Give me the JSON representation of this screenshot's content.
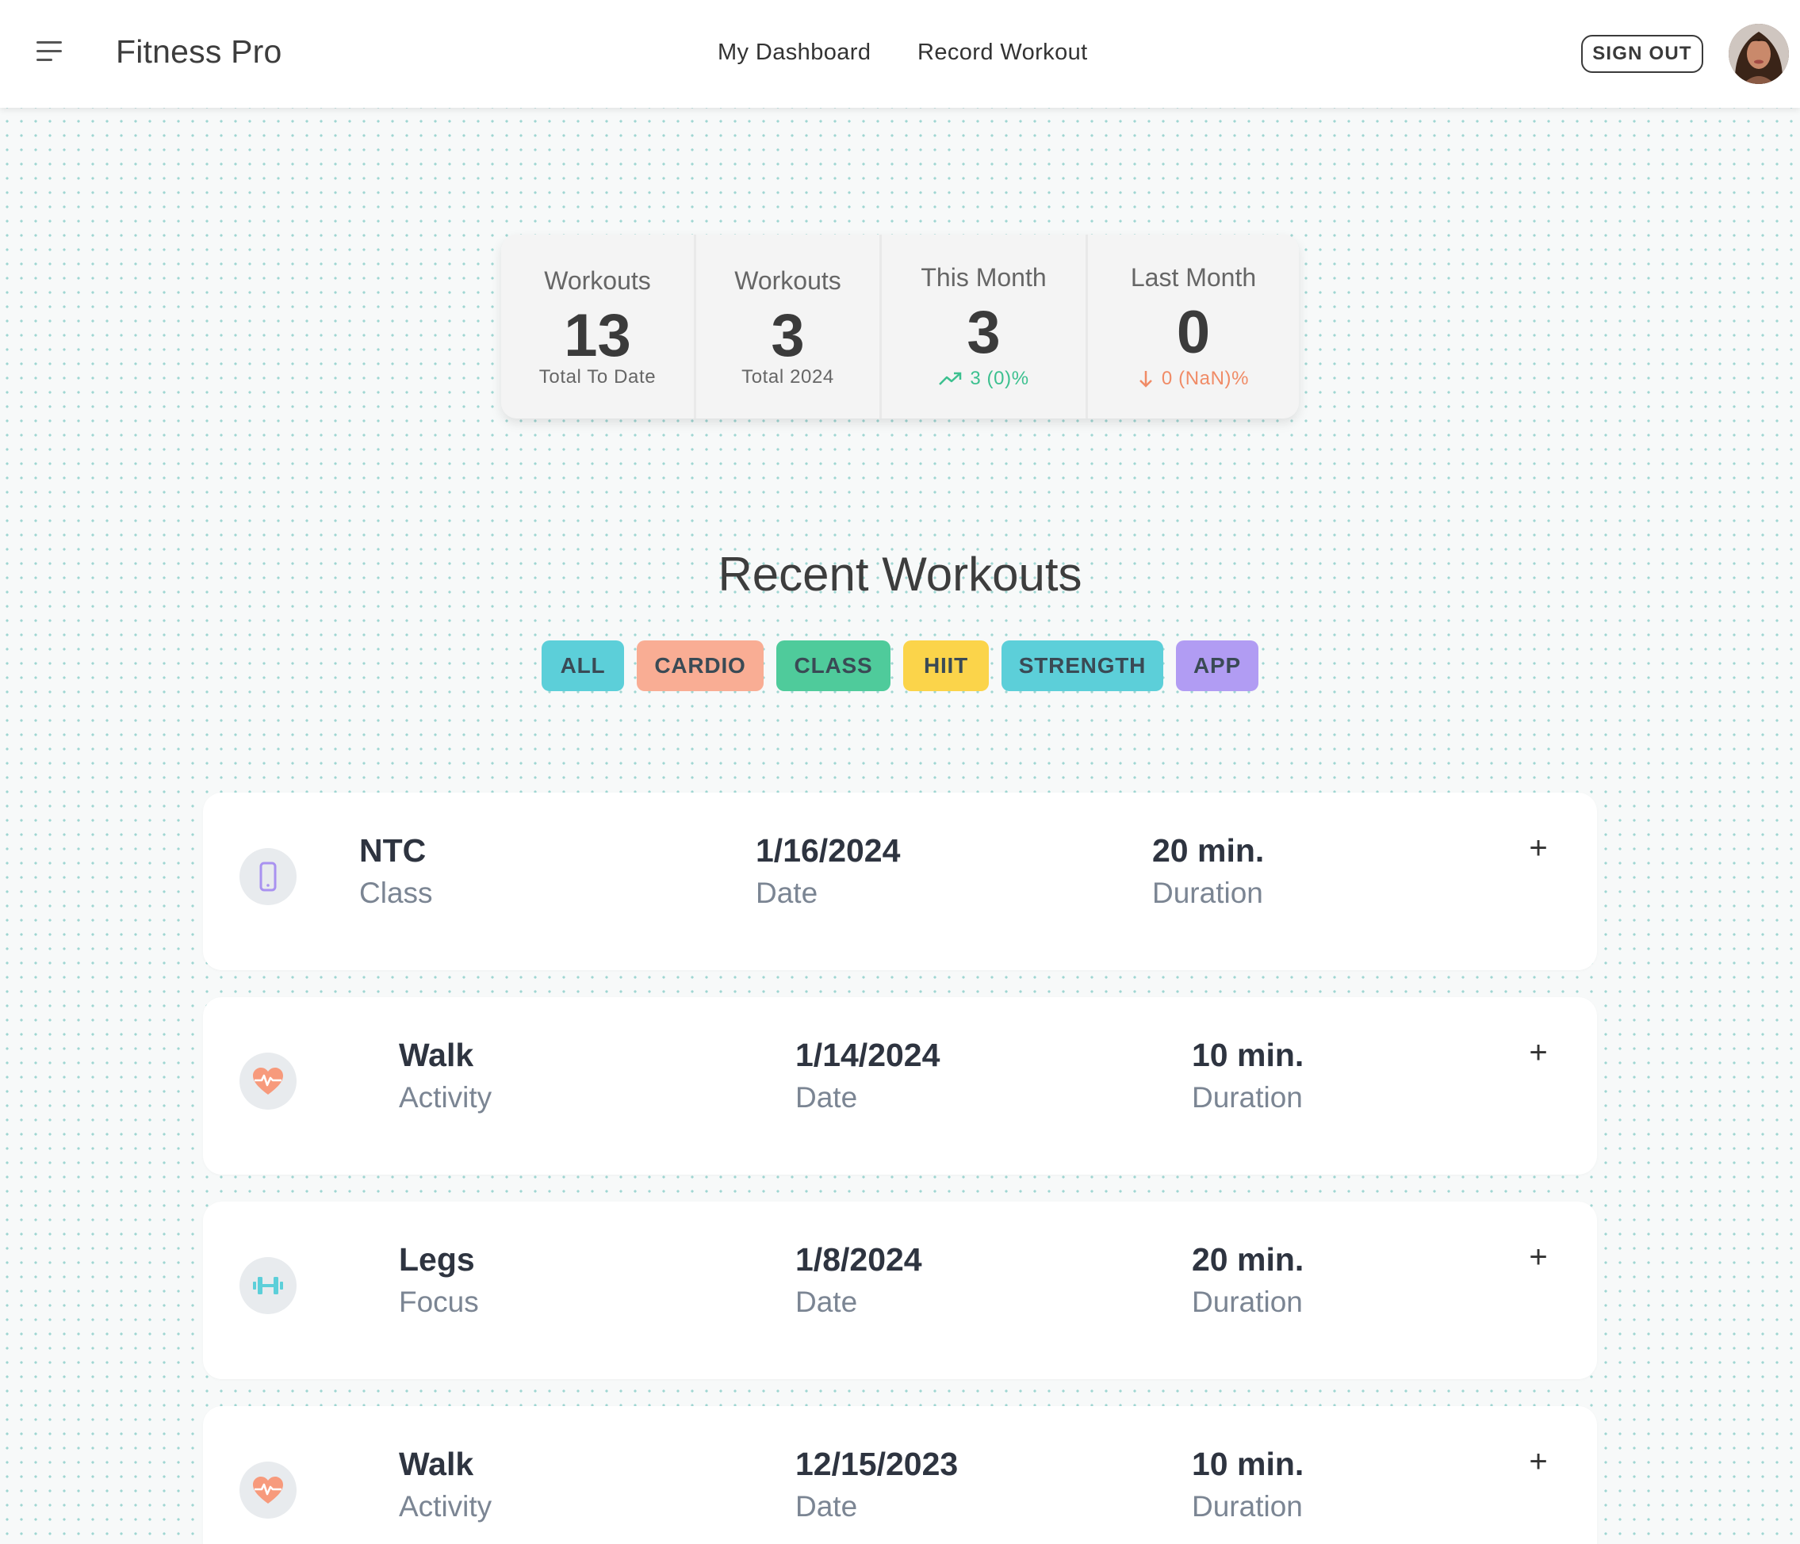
{
  "header": {
    "app_title": "Fitness Pro",
    "nav": [
      "My Dashboard",
      "Record Workout"
    ],
    "sign_out_label": "SIGN OUT",
    "menu_icon": "menu-icon",
    "avatar": "user-avatar"
  },
  "stats": [
    {
      "label": "Workouts",
      "value": "13",
      "sub": "Total To Date"
    },
    {
      "label": "Workouts",
      "value": "3",
      "sub": "Total 2024"
    },
    {
      "label": "This Month",
      "value": "3",
      "change": "3 (0)%",
      "trend": "up",
      "color": "#3cc08f"
    },
    {
      "label": "Last Month",
      "value": "0",
      "change": "0 (NaN)%",
      "trend": "down",
      "color": "#f08b66"
    }
  ],
  "section_title": "Recent Workouts",
  "filters": [
    {
      "label": "ALL",
      "color": "#5ccfd9"
    },
    {
      "label": "CARDIO",
      "color": "#f9ad94"
    },
    {
      "label": "CLASS",
      "color": "#4fcb9b"
    },
    {
      "label": "HIIT",
      "color": "#fbd44a"
    },
    {
      "label": "STRENGTH",
      "color": "#5ccfd9"
    },
    {
      "label": "APP",
      "color": "#b19cf3"
    }
  ],
  "workouts": [
    {
      "name": "NTC",
      "name_label": "Class",
      "date": "1/16/2024",
      "date_label": "Date",
      "duration": "20 min.",
      "duration_label": "Duration",
      "icon": "phone-icon",
      "expand": "+"
    },
    {
      "name": "Walk",
      "name_label": "Activity",
      "date": "1/14/2024",
      "date_label": "Date",
      "duration": "10 min.",
      "duration_label": "Duration",
      "icon": "heart-pulse-icon",
      "expand": "+"
    },
    {
      "name": "Legs",
      "name_label": "Focus",
      "date": "1/8/2024",
      "date_label": "Date",
      "duration": "20 min.",
      "duration_label": "Duration",
      "icon": "dumbbell-icon",
      "expand": "+"
    },
    {
      "name": "Walk",
      "name_label": "Activity",
      "date": "12/15/2023",
      "date_label": "Date",
      "duration": "10 min.",
      "duration_label": "Duration",
      "icon": "heart-pulse-icon",
      "expand": "+"
    }
  ]
}
